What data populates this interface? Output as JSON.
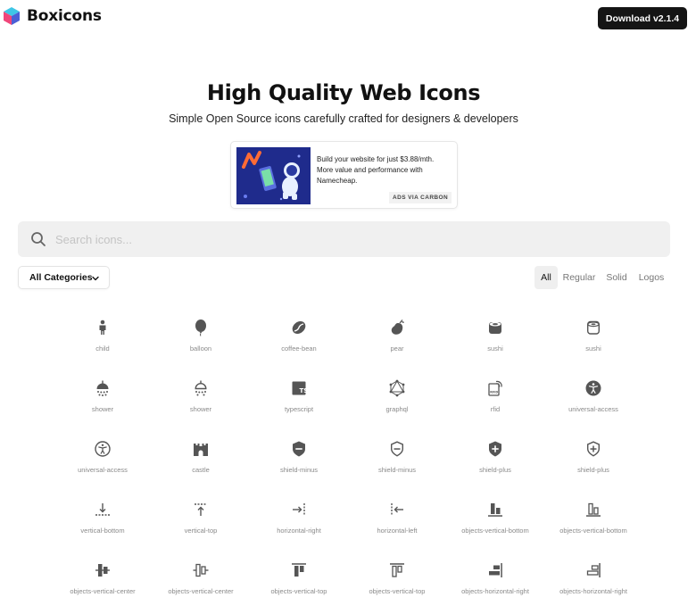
{
  "brand": {
    "name": "Boxicons",
    "colors": {
      "cyan": "#3ec6e6",
      "pink": "#f0467a",
      "blue": "#4b5fd6"
    }
  },
  "header": {
    "download_label": "Download v2.1.4"
  },
  "hero": {
    "title": "High Quality Web Icons",
    "subtitle": "Simple Open Source icons carefully crafted for designers & developers"
  },
  "ad": {
    "text": "Build your website for just $3.88/mth. More value and performance with Namecheap.",
    "via": "ADS VIA CARBON"
  },
  "search": {
    "placeholder": "Search icons...",
    "value": ""
  },
  "filters": {
    "category_selected": "All Categories",
    "tabs": [
      {
        "label": "All",
        "active": true
      },
      {
        "label": "Regular",
        "active": false
      },
      {
        "label": "Solid",
        "active": false
      },
      {
        "label": "Logos",
        "active": false
      }
    ]
  },
  "icons": [
    {
      "name": "child",
      "icon": "child-icon"
    },
    {
      "name": "balloon",
      "icon": "balloon-icon"
    },
    {
      "name": "coffee-bean",
      "icon": "coffee-bean-icon"
    },
    {
      "name": "pear",
      "icon": "pear-icon"
    },
    {
      "name": "sushi",
      "icon": "sushi-solid-icon"
    },
    {
      "name": "sushi",
      "icon": "sushi-regular-icon"
    },
    {
      "name": "shower",
      "icon": "shower-solid-icon"
    },
    {
      "name": "shower",
      "icon": "shower-regular-icon"
    },
    {
      "name": "typescript",
      "icon": "typescript-icon"
    },
    {
      "name": "graphql",
      "icon": "graphql-icon"
    },
    {
      "name": "rfid",
      "icon": "rfid-icon"
    },
    {
      "name": "universal-access",
      "icon": "universal-access-solid-icon"
    },
    {
      "name": "universal-access",
      "icon": "universal-access-regular-icon"
    },
    {
      "name": "castle",
      "icon": "castle-icon"
    },
    {
      "name": "shield-minus",
      "icon": "shield-minus-solid-icon"
    },
    {
      "name": "shield-minus",
      "icon": "shield-minus-regular-icon"
    },
    {
      "name": "shield-plus",
      "icon": "shield-plus-solid-icon"
    },
    {
      "name": "shield-plus",
      "icon": "shield-plus-regular-icon"
    },
    {
      "name": "vertical-bottom",
      "icon": "vertical-bottom-icon"
    },
    {
      "name": "vertical-top",
      "icon": "vertical-top-icon"
    },
    {
      "name": "horizontal-right",
      "icon": "horizontal-right-icon"
    },
    {
      "name": "horizontal-left",
      "icon": "horizontal-left-icon"
    },
    {
      "name": "objects-vertical-bottom",
      "icon": "objects-vertical-bottom-solid-icon"
    },
    {
      "name": "objects-vertical-bottom",
      "icon": "objects-vertical-bottom-regular-icon"
    },
    {
      "name": "objects-vertical-center",
      "icon": "objects-vertical-center-solid-icon"
    },
    {
      "name": "objects-vertical-center",
      "icon": "objects-vertical-center-regular-icon"
    },
    {
      "name": "objects-vertical-top",
      "icon": "objects-vertical-top-solid-icon"
    },
    {
      "name": "objects-vertical-top",
      "icon": "objects-vertical-top-regular-icon"
    },
    {
      "name": "objects-horizontal-right",
      "icon": "objects-horizontal-right-solid-icon"
    },
    {
      "name": "objects-horizontal-right",
      "icon": "objects-horizontal-right-regular-icon"
    }
  ]
}
